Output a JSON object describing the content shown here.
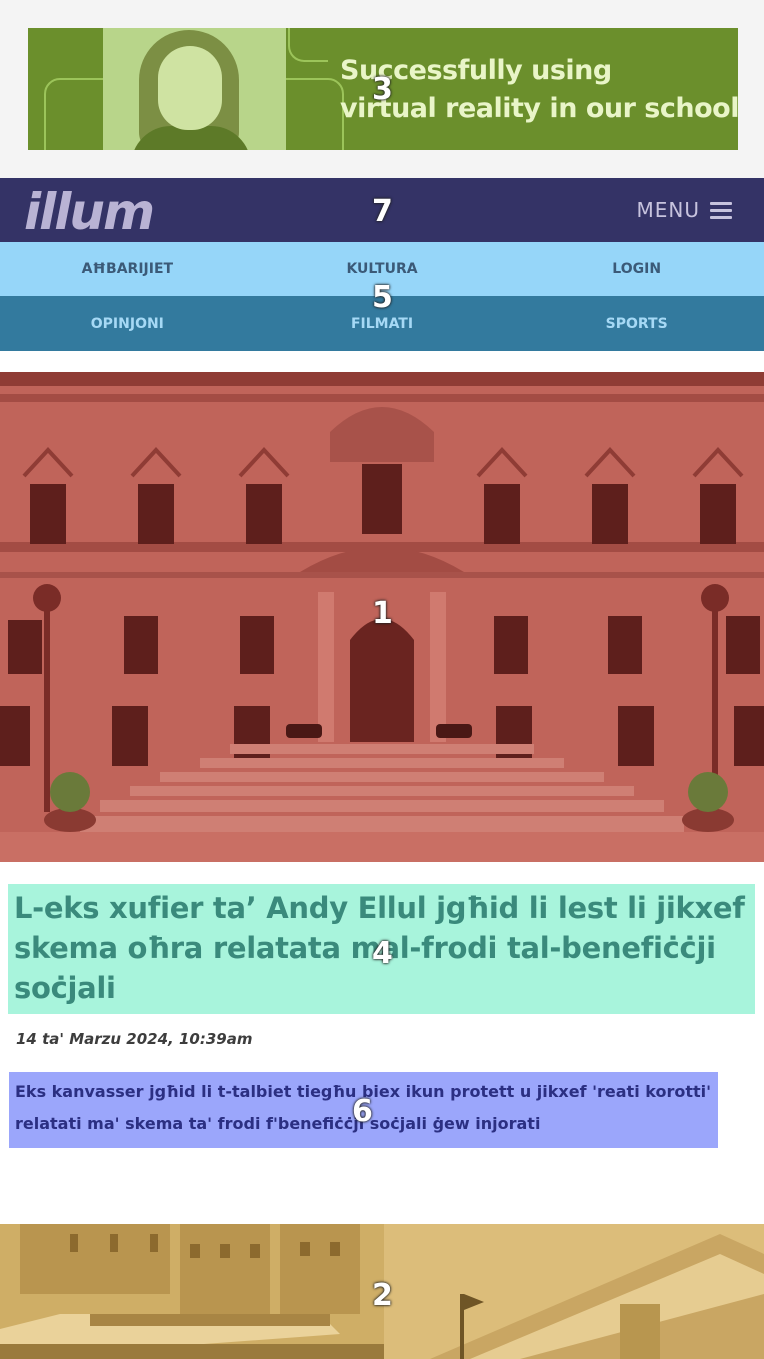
{
  "ad": {
    "line1": "Successfully using",
    "line2": "virtual reality in our school",
    "colors": {
      "background": "#6b8f2c",
      "text": "#e9f5c8"
    }
  },
  "header": {
    "logo": "illum",
    "menu_label": "MENU",
    "menu_icon": "hamburger-icon",
    "background": "#343366"
  },
  "nav": {
    "row1": [
      {
        "label": "AĦBARIJIET"
      },
      {
        "label": "KULTURA"
      },
      {
        "label": "LOGIN"
      }
    ],
    "row2": [
      {
        "label": "OPINJONI"
      },
      {
        "label": "FILMATI"
      },
      {
        "label": "SPORTS"
      }
    ]
  },
  "article": {
    "headline": "L-eks xufier ta’ Andy Ellul jgħid li lest li jikxef skema oħra relatata mal-frodi tal-benefiċċji soċjali",
    "date": "14 ta' Marzu 2024, 10:39am",
    "summary": "Eks kanvasser jgħid li t-talbiet tiegħu biex ikun protett u jikxef 'reati korotti' relatati ma' skema ta' frodi f'benefiċċji soċjali ġew injorati"
  },
  "badges": {
    "hero": "1",
    "teaser": "2",
    "ad": "3",
    "headline": "4",
    "nav": "5",
    "summary": "6",
    "header": "7"
  },
  "colors": {
    "hero_overlay": "#c0645a",
    "headline_bg": "#a8f4dc",
    "summary_bg": "#9ba6fb",
    "nav_row1": "#96d6f9",
    "nav_row2": "#337a9e",
    "teaser_overlay": "#d7b46a"
  }
}
